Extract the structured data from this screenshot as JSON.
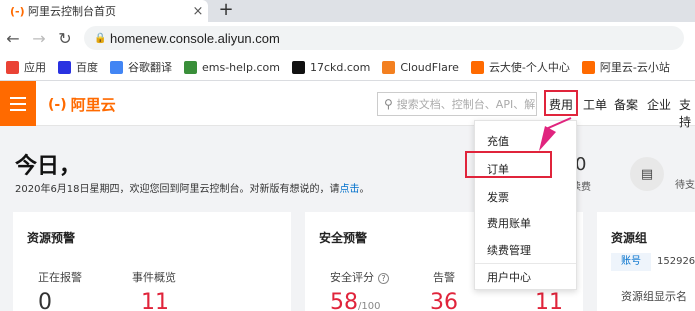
{
  "browser": {
    "tab_title": "阿里云控制台首页",
    "url": "homenew.console.aliyun.com",
    "bookmarks": [
      {
        "label": "应用",
        "icon": "apps-grid-icon",
        "color": "#ea4335"
      },
      {
        "label": "百度",
        "icon": "baidu-paw-icon",
        "color": "#2932e1"
      },
      {
        "label": "谷歌翻译",
        "icon": "google-translate-icon",
        "color": "#4285f4"
      },
      {
        "label": "ems-help.com",
        "icon": "ems-icon",
        "color": "#3a8f3a"
      },
      {
        "label": "17ckd.com",
        "icon": "17-logo-icon",
        "color": "#111111"
      },
      {
        "label": "CloudFlare",
        "icon": "cloudflare-icon",
        "color": "#f38020"
      },
      {
        "label": "云大使-个人中心",
        "icon": "aliyun-logo-icon",
        "color": "#ff6a00"
      },
      {
        "label": "阿里云-云小站",
        "icon": "aliyun-logo-icon",
        "color": "#ff6a00"
      }
    ]
  },
  "header": {
    "logo_text": "阿里云",
    "search_placeholder": "搜索文档、控制台、API、解决",
    "nav": [
      "费用",
      "工单",
      "备案",
      "企业",
      "支持"
    ]
  },
  "dropdown": {
    "items": [
      "充值",
      "订单",
      "发票",
      "费用账单",
      "续费管理"
    ],
    "footer_item": "用户中心",
    "highlighted": "订单"
  },
  "greeting": {
    "title": "今日，",
    "subtitle_prefix": "2020年6月18日星期四，欢迎您回到阿里云控制台。对新版有想说的，请",
    "subtitle_link": "点击",
    "subtitle_suffix": "。"
  },
  "summary": {
    "renew_value": "0",
    "renew_label": "续费",
    "wait_label": "待支"
  },
  "cards": {
    "resource_warning": {
      "title": "资源预警",
      "alarm_label": "正在报警",
      "event_label": "事件概览",
      "alarm_value": "0",
      "event_value": "11"
    },
    "security_warning": {
      "title": "安全预警",
      "score_label": "安全评分",
      "alert_label": "告警",
      "score_value": "58",
      "score_suffix": "/100",
      "alert_value": "36",
      "third_value": "11"
    },
    "resource_group": {
      "title": "资源组",
      "account_tag": "账号",
      "account_value": "152926",
      "group_name_label": "资源组显示名"
    }
  },
  "colors": {
    "brand": "#ff6a00",
    "highlight": "#e0243b",
    "arrow": "#e0247e",
    "link": "#0070cc"
  }
}
